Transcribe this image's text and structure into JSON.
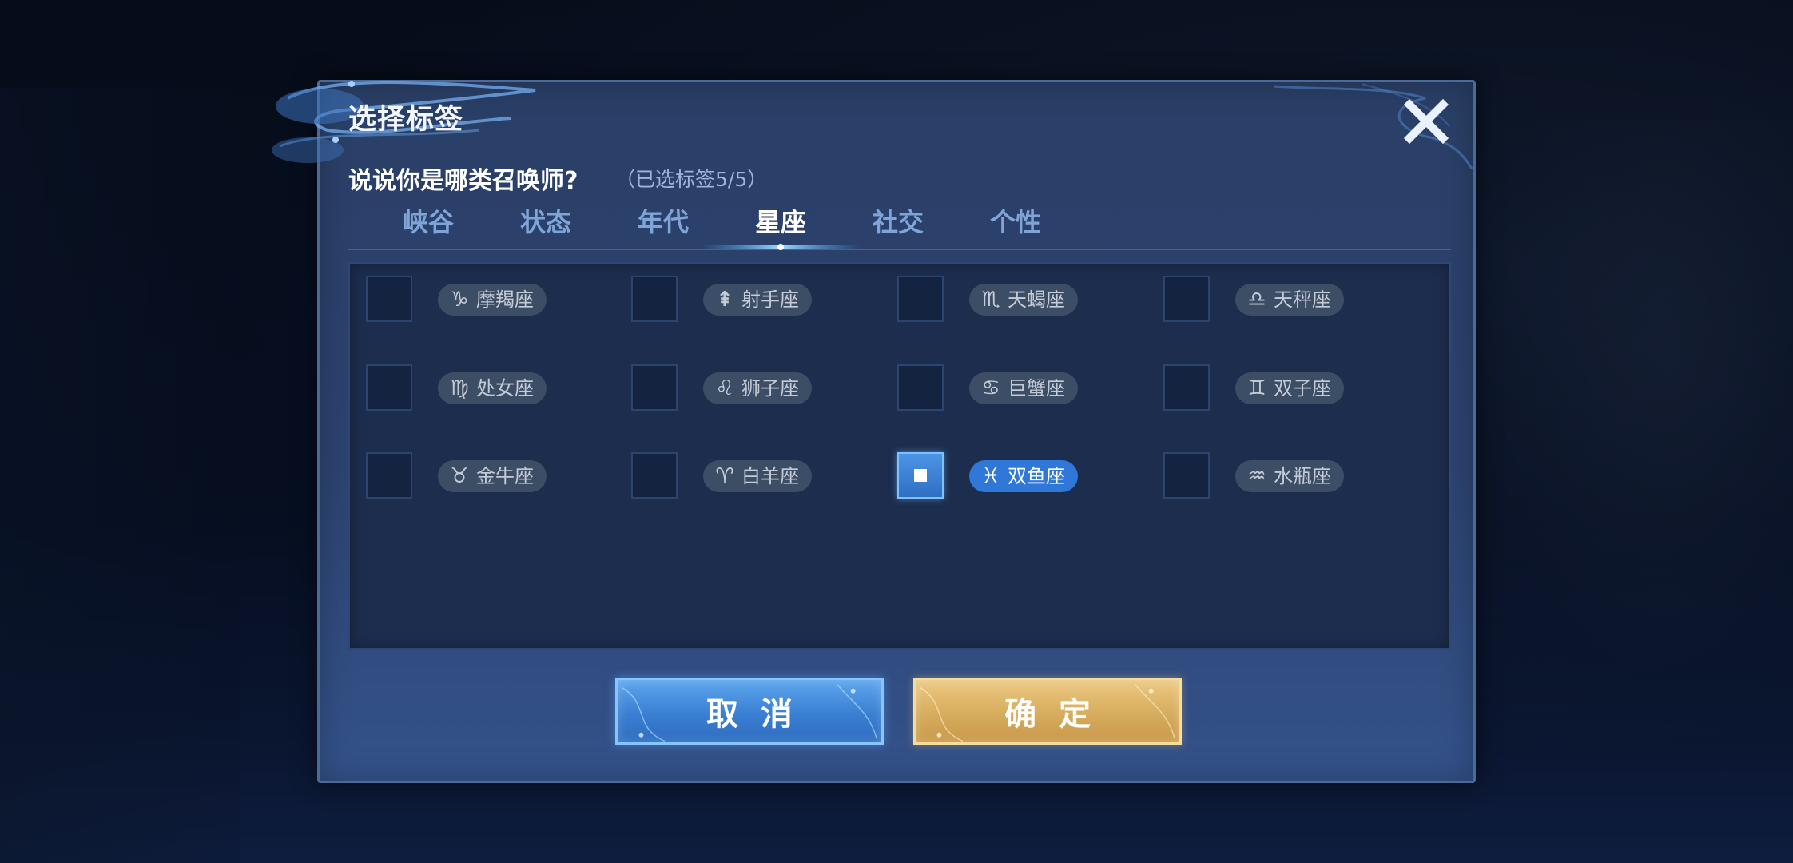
{
  "dialog": {
    "title": "选择标签",
    "subtitle": "说说你是哪类召唤师?",
    "selected_count": "（已选标签5/5）"
  },
  "tabs": [
    {
      "label": "峡谷",
      "active": false
    },
    {
      "label": "状态",
      "active": false
    },
    {
      "label": "年代",
      "active": false
    },
    {
      "label": "星座",
      "active": true
    },
    {
      "label": "社交",
      "active": false
    },
    {
      "label": "个性",
      "active": false
    }
  ],
  "tags": [
    {
      "icon": "♑",
      "label": "摩羯座",
      "checked": false
    },
    {
      "icon": "⇞",
      "label": "射手座",
      "checked": false
    },
    {
      "icon": "♏",
      "label": "天蝎座",
      "checked": false
    },
    {
      "icon": "♎",
      "label": "天秤座",
      "checked": false
    },
    {
      "icon": "♍",
      "label": "处女座",
      "checked": false
    },
    {
      "icon": "♌",
      "label": "狮子座",
      "checked": false
    },
    {
      "icon": "♋",
      "label": "巨蟹座",
      "checked": false
    },
    {
      "icon": "♊",
      "label": "双子座",
      "checked": false
    },
    {
      "icon": "♉",
      "label": "金牛座",
      "checked": false
    },
    {
      "icon": "♈",
      "label": "白羊座",
      "checked": false
    },
    {
      "icon": "♓",
      "label": "双鱼座",
      "checked": true
    },
    {
      "icon": "♒",
      "label": "水瓶座",
      "checked": false
    }
  ],
  "buttons": {
    "cancel": "取消",
    "confirm": "确定"
  },
  "colors": {
    "accent_blue": "#2f78d8",
    "confirm_gold": "#d7ac5e",
    "dialog_bg": "#2c4370"
  }
}
